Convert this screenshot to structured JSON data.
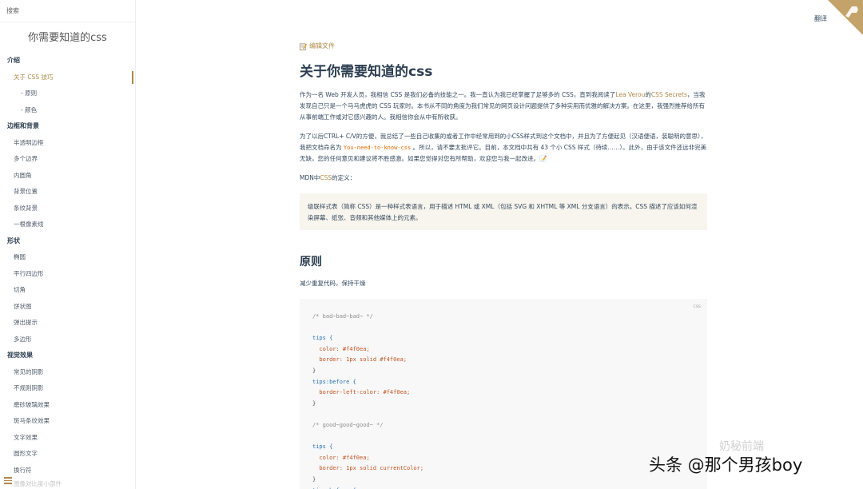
{
  "sidebar": {
    "search_label": "搜索",
    "app_name": "你需要知道的css",
    "sections": [
      {
        "title": "介绍",
        "items": [
          {
            "label": "关于 CSS 技巧",
            "active": true,
            "sub": [
              "- 原则",
              "- 颜色"
            ]
          }
        ]
      },
      {
        "title": "边框和背景",
        "items": [
          {
            "label": "半透明边框"
          },
          {
            "label": "多个边界"
          },
          {
            "label": "内圆角"
          },
          {
            "label": "背景位置"
          },
          {
            "label": "条纹背景"
          },
          {
            "label": "一根像素线"
          }
        ]
      },
      {
        "title": "形状",
        "items": [
          {
            "label": "椭圆"
          },
          {
            "label": "平行四边形"
          },
          {
            "label": "切角"
          },
          {
            "label": "饼状图"
          },
          {
            "label": "弹出提示"
          },
          {
            "label": "多边形"
          }
        ]
      },
      {
        "title": "视觉效果",
        "items": [
          {
            "label": "常见的阴影"
          },
          {
            "label": "不规则阴影"
          },
          {
            "label": "磨砂玻璃效果"
          },
          {
            "label": "斑马条纹效果"
          },
          {
            "label": "文字效果"
          },
          {
            "label": "圆形文字"
          },
          {
            "label": "换行符"
          }
        ]
      }
    ],
    "faded_item": "图像对比度小部件"
  },
  "header": {
    "translate_label": "翻译"
  },
  "main": {
    "edit_label": "编辑文件",
    "title": "关于你需要知道的css",
    "intro": {
      "t1": "作为一名 Web 开发人员，我相信 CSS 是我们必备的技能之一。我一直认为我已经掌握了足够多的 CSS，直到我阅读了",
      "link1": "Lea Verou",
      "t2": "的",
      "link2": "CSS Secrets",
      "t3": "，当我发现自己只是一个马马虎虎的 CSS 玩家时。本书从不同的角度为我们常见的网页设计问题提供了多种实用而优雅的解决方案。在这里，我强烈推荐给所有从事前端工作或对它感兴趣的人。我相信你会从中有所收获。"
    },
    "para2": {
      "t1": "为了以后CTRL+ C/V的方便，我总结了一些自己收集的或者工作中经常用到的小CSS样式到这个文档中，并且为了方便起见（汉语便语，装聪明的意思），我把文档命名为 ",
      "code": "You-need-to-know-css",
      "t2": " 。所以，请不要太批评它。目前，本文档中共有 43 个小 CSS 样式（待续……）。此外，由于该文件还远非完美无缺，您的任何意见和建议将不胜感激。如果您觉得对您有所帮助，欢迎您与我一起改进。📝"
    },
    "mdn": {
      "t1": "MDN中",
      "link": "CSS",
      "t2": "的定义："
    },
    "quote": "级联样式表（简称 CSS）是一种样式表语言，用于描述 HTML 或 XML（包括 SVG 和 XHTML 等 XML 分支语言）的表示。CSS 描述了应该如何渲染屏幕、纸张、音频和其他媒体上的元素。",
    "section_title": "原则",
    "section_desc": "减少重复代码，保持干燥",
    "code_lang": "css",
    "code_lines": [
      {
        "kind": "com",
        "text": "/* bad~bad~bad~ */"
      },
      {
        "kind": "blank",
        "text": ""
      },
      {
        "kind": "sel",
        "text": "tips {"
      },
      {
        "kind": "prop",
        "text": "  color: #f4f0ea;"
      },
      {
        "kind": "prop",
        "text": "  border: 1px solid #f4f0ea;"
      },
      {
        "kind": "plain",
        "text": "}"
      },
      {
        "kind": "sel",
        "text": "tips:before {"
      },
      {
        "kind": "prop",
        "text": "  border-left-color: #f4f0ea;"
      },
      {
        "kind": "plain",
        "text": "}"
      },
      {
        "kind": "blank",
        "text": ""
      },
      {
        "kind": "com",
        "text": "/* good~good~good~ */"
      },
      {
        "kind": "blank",
        "text": ""
      },
      {
        "kind": "sel",
        "text": "tips {"
      },
      {
        "kind": "prop",
        "text": "  color: #f4f0ea;"
      },
      {
        "kind": "prop",
        "text": "  border: 1px solid currentColor;"
      },
      {
        "kind": "plain",
        "text": "}"
      },
      {
        "kind": "sel",
        "text": "tips:before {"
      }
    ]
  },
  "watermarks": {
    "wechat": "奶秘前端",
    "toutiao": "头条 @那个男孩boy"
  },
  "colors": {
    "accent": "#b08a4a",
    "quote_bg": "#f8f5ee",
    "code_bg": "#f8f8f8"
  }
}
